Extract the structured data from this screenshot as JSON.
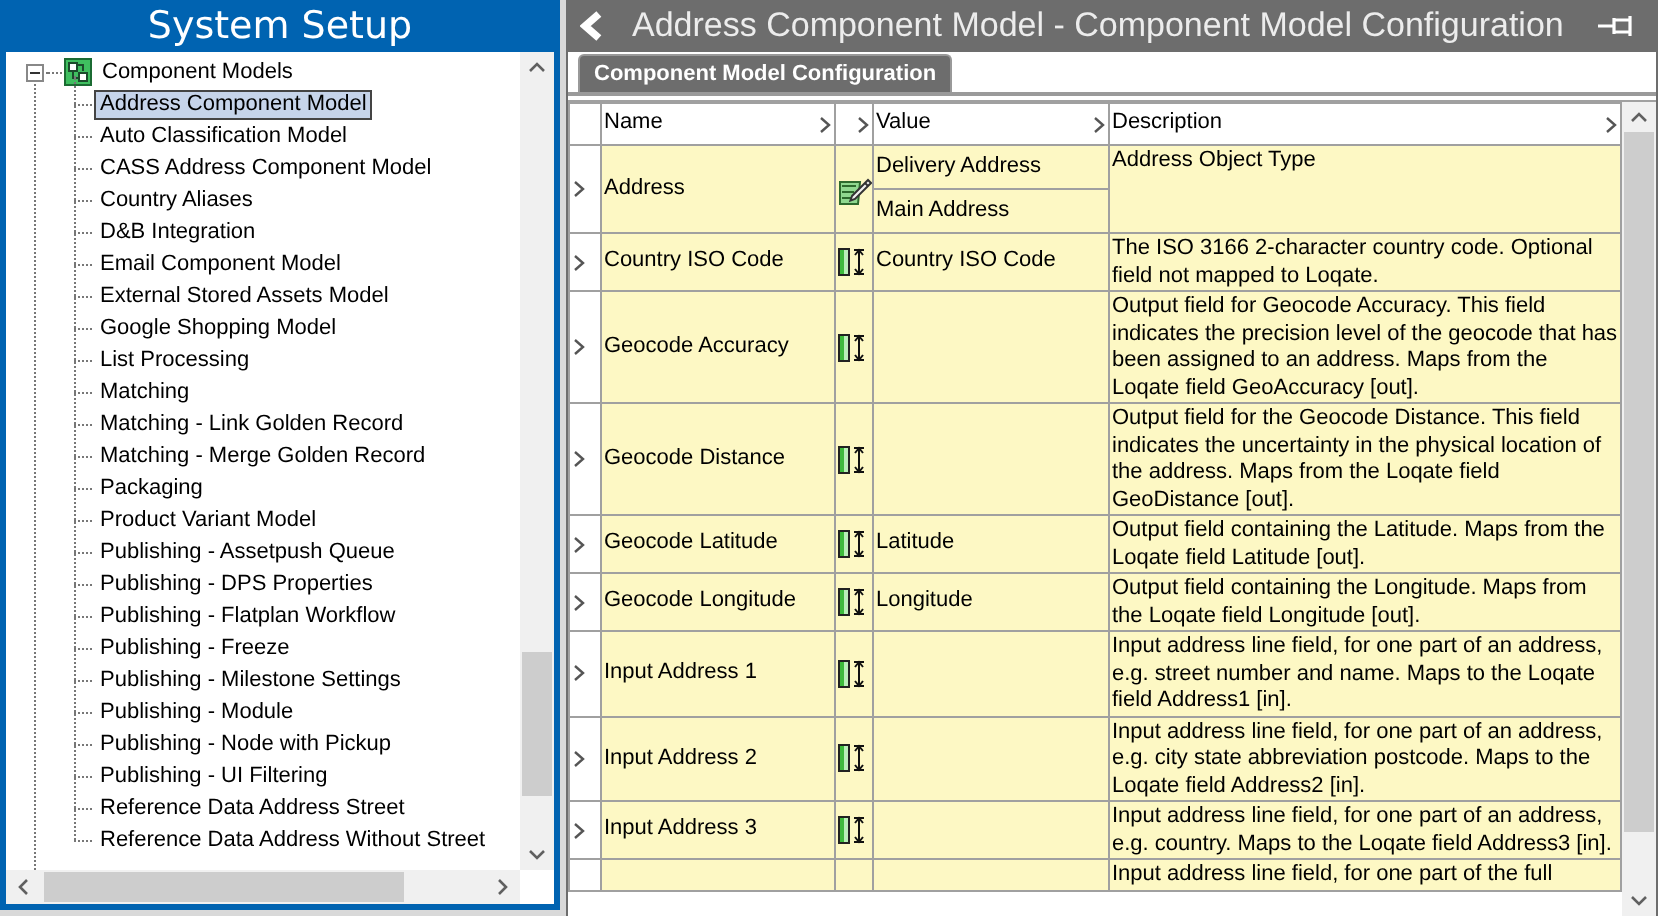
{
  "tree_panel": {
    "title": "System Setup",
    "root": {
      "label": "Component Models",
      "expanded": true,
      "children": [
        {
          "label": "Address Component Model",
          "selected": true
        },
        {
          "label": "Auto Classification Model",
          "selected": false
        },
        {
          "label": "CASS Address Component Model",
          "selected": false
        },
        {
          "label": "Country Aliases",
          "selected": false
        },
        {
          "label": "D&B Integration",
          "selected": false
        },
        {
          "label": "Email Component Model",
          "selected": false
        },
        {
          "label": "External Stored Assets Model",
          "selected": false
        },
        {
          "label": "Google Shopping Model",
          "selected": false
        },
        {
          "label": "List Processing",
          "selected": false
        },
        {
          "label": "Matching",
          "selected": false
        },
        {
          "label": "Matching - Link Golden Record",
          "selected": false
        },
        {
          "label": "Matching - Merge Golden Record",
          "selected": false
        },
        {
          "label": "Packaging",
          "selected": false
        },
        {
          "label": "Product Variant Model",
          "selected": false
        },
        {
          "label": "Publishing - Assetpush Queue",
          "selected": false
        },
        {
          "label": "Publishing - DPS Properties",
          "selected": false
        },
        {
          "label": "Publishing - Flatplan Workflow",
          "selected": false
        },
        {
          "label": "Publishing - Freeze",
          "selected": false
        },
        {
          "label": "Publishing - Milestone Settings",
          "selected": false
        },
        {
          "label": "Publishing - Module",
          "selected": false
        },
        {
          "label": "Publishing - Node with Pickup",
          "selected": false
        },
        {
          "label": "Publishing - UI Filtering",
          "selected": false
        },
        {
          "label": "Reference Data Address Street",
          "selected": false
        },
        {
          "label": "Reference Data Address Without Street",
          "selected": false
        }
      ]
    }
  },
  "config_panel": {
    "title": "Address Component Model - Component Model Configuration",
    "tabs": [
      {
        "label": "Component Model Configuration",
        "selected": true
      }
    ],
    "table": {
      "columns": [
        "Name",
        "",
        "Value",
        "Description"
      ],
      "rows": [
        {
          "kind": "object",
          "name": "Address",
          "values": [
            "Delivery Address",
            "Main Address"
          ],
          "description": "Address Object Type"
        },
        {
          "kind": "field",
          "name": "Country ISO Code",
          "values": [
            "Country ISO Code"
          ],
          "description": "The ISO 3166 2-character country code. Optional field not mapped to Loqate."
        },
        {
          "kind": "field",
          "name": "Geocode Accuracy",
          "values": [],
          "description": "Output field for Geocode Accuracy. This field indicates the precision level of the geocode that has been assigned to an address. Maps from the Loqate field GeoAccuracy [out]."
        },
        {
          "kind": "field",
          "name": "Geocode Distance",
          "values": [],
          "description": "Output field for the Geocode Distance. This field indicates the uncertainty in the physical location of the address. Maps from the Loqate field GeoDistance [out]."
        },
        {
          "kind": "field",
          "name": "Geocode Latitude",
          "values": [
            "Latitude"
          ],
          "description": "Output field containing the Latitude. Maps from the Loqate field Latitude [out]."
        },
        {
          "kind": "field",
          "name": "Geocode Longitude",
          "values": [
            "Longitude"
          ],
          "description": "Output field containing the Longitude. Maps from the Loqate field Longitude [out]."
        },
        {
          "kind": "field",
          "name": "Input Address 1",
          "values": [],
          "description": "Input address line field, for one part of an address, e.g. street number and name. Maps to the Loqate field Address1 [in]."
        },
        {
          "kind": "field",
          "name": "Input Address 2",
          "values": [],
          "description": "Input address line field, for one part of an address, e.g. city state abbreviation postcode. Maps to the Loqate field Address2 [in]."
        },
        {
          "kind": "field",
          "name": "Input Address 3",
          "values": [],
          "description": "Input address line field, for one part of an address, e.g. country. Maps to the Loqate field Address3 [in]."
        },
        {
          "kind": "field",
          "name": "",
          "values": [],
          "description": "Input address line field, for one part of the full"
        }
      ]
    }
  }
}
